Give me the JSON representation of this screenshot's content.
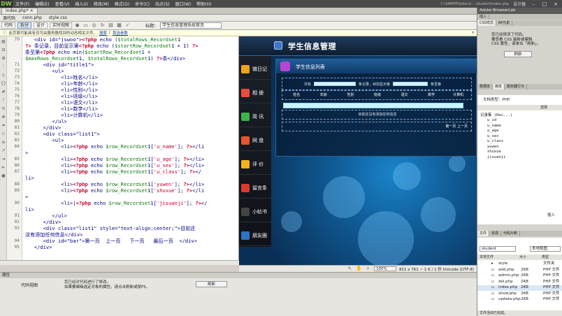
{
  "app": {
    "logo": "DW",
    "menus": [
      "文件(F)",
      "编辑(E)",
      "查看(V)",
      "插入(I)",
      "修改(M)",
      "格式(O)",
      "命令(C)",
      "站点(S)",
      "窗口(W)",
      "帮助(H)"
    ],
    "path": "C:\\XAMPP\\htdocs\\... \\student\\index.php",
    "user": "设计器",
    "min": "–",
    "max": "□",
    "close": "×"
  },
  "doctab": {
    "label": "index.php*",
    "close": "×"
  },
  "related_files": [
    "源代码",
    "conn.php",
    "style.css"
  ],
  "toolbar": {
    "code": "代码",
    "split": "拆分",
    "design": "设计",
    "live": "实时视图",
    "title_label": "标题：",
    "title_value": "学生信息管理系统首页"
  },
  "infobar": {
    "message": "此页面可能具有仅可由服务器找到的动态相关文件。",
    "link1": "搜索",
    "sep": "|",
    "link2": "首选参数",
    "close": "×"
  },
  "code": {
    "lines": [
      {
        "n": "70",
        "html": "   <div id=\"jswoo\"><?php echo ($totalRows_Recordset1"
      },
      {
        "n": "",
        "html": "?> 条记录，目前显示第<?php echo ($startRow_Recordset1 + 1) ?>"
      },
      {
        "n": "",
        "html": "条至第<?php echo min($startRow_Recordset1 +"
      },
      {
        "n": "",
        "html": "$maxRows_Recordset1, $totalRows_Recordset1) ?>条</div>"
      },
      {
        "n": "71",
        "html": "      <div id=\"title1\">"
      },
      {
        "n": "72",
        "html": "         <ul>"
      },
      {
        "n": "73",
        "html": "            <li>姓名</li>"
      },
      {
        "n": "74",
        "html": "            <li>年龄</li>"
      },
      {
        "n": "75",
        "html": "            <li>性别</li>"
      },
      {
        "n": "76",
        "html": "            <li>班级</li>"
      },
      {
        "n": "77",
        "html": "            <li>语文</li>"
      },
      {
        "n": "78",
        "html": "            <li>数学</li>"
      },
      {
        "n": "79",
        "html": "            <li>计算机</li>"
      },
      {
        "n": "80",
        "html": "         </ul>"
      },
      {
        "n": "81",
        "html": "      </div>"
      },
      {
        "n": "82",
        "html": "      <div class=\"list1\">"
      },
      {
        "n": "83",
        "html": "         <ul>"
      },
      {
        "n": "84",
        "html": "            <li><?php echo $row_Recordset1['u_name']; ?></li"
      },
      {
        "n": "",
        "html": ">"
      },
      {
        "n": "85",
        "html": "            <li><?php echo $row_Recordset1['u_age']; ?></li>"
      },
      {
        "n": "86",
        "html": "            <li><?php echo $row_Recordset1['u_sex']; ?></li>"
      },
      {
        "n": "87",
        "html": "            <li><?php echo $row_Recordset1['u_class']; ?></"
      },
      {
        "n": "",
        "html": "li>"
      },
      {
        "n": "88",
        "html": "            <li><?php echo $row_Recordset1['yuwen']; ?></li>"
      },
      {
        "n": "89",
        "html": "            <li><?php echo $row_Recordset1['shuxue']; ?></li"
      },
      {
        "n": "",
        "html": ">"
      },
      {
        "n": "90",
        "html": "            <li>|<?php echo $row_Recordset1['jisuanji']; ?></"
      },
      {
        "n": "",
        "html": "li>"
      },
      {
        "n": "91",
        "html": "         </ul>"
      },
      {
        "n": "92",
        "html": "      </div>"
      },
      {
        "n": "93",
        "html": "      <div class=\"list1\" style=\"text-align:center;\">目前还"
      },
      {
        "n": "",
        "html": "没有添加任何信息</div>"
      },
      {
        "n": "94",
        "html": "      <div id=\"bar\">第一页  上一页   下一页   最后一页  </div>"
      },
      {
        "n": "95",
        "html": "   </div>"
      }
    ]
  },
  "design": {
    "header_title": "学生信息管理",
    "sidebar": [
      {
        "label": "微日记",
        "color": "#f0a21b"
      },
      {
        "label": "相 册",
        "color": "#e84d3c"
      },
      {
        "label": "简 讯",
        "color": "#3cb44b"
      },
      {
        "label": "网 盘",
        "color": "#e8542f"
      },
      {
        "label": "评 价",
        "color": "#f2b21c"
      },
      {
        "label": "留言条",
        "color": "#d93b2f"
      },
      {
        "label": "小帖书",
        "color": "#444444"
      },
      {
        "label": "朋友圈",
        "color": "#2b74c7"
      }
    ],
    "panel_title": "学生信息列表",
    "summary_pre": "共有",
    "summary_mid": "条记录，目前显示第",
    "summary_post": "条至第",
    "columns": [
      "姓名",
      "年龄",
      "性别",
      "班级",
      "语文",
      "数学",
      "计算机"
    ],
    "empty": "目前还没有添加任何信息",
    "nav": "第一页  上一页"
  },
  "status": {
    "zoom": "100%",
    "info": "811 x 761 ~ 1 K / 1 秒 Unicode (UTF-8)"
  },
  "properties": {
    "header": "属性",
    "label": "代码视图",
    "message_1": "您已经对代码进行了修改。",
    "message_2": "如果要编辑选定对象的属性，请点击刷新或按F5。",
    "refresh": "刷新"
  },
  "right": {
    "browserlab": "Adobe BrowserLab",
    "tabs1": [
      "插入",
      "CSS样式",
      "AP元素"
    ],
    "css_msg_1": "您已经修改了代码。",
    "css_msg_2": "要查看 CSS 最新或编辑",
    "css_msg_3": "CSS 属性，请单击「刷新」。",
    "refresh": "刷新",
    "tabs2": [
      "数据库",
      "绑定",
      "服务器行为"
    ],
    "doctype": "文档类型：PHP",
    "bind_cols": [
      "",
      "",
      "选择"
    ],
    "recordset": "记录集 (Rec...)",
    "bind_items": [
      "u_id",
      "u_name",
      "u_age",
      "u_sex",
      "u_class",
      "yuwen",
      "shuxue",
      "jisuanji"
    ],
    "insert": "插入",
    "tabs3": [
      "文件",
      "资源",
      "代码片断"
    ],
    "site": "student",
    "view": "本地视图",
    "file_cols": [
      "本地文件",
      "大小",
      "类型"
    ],
    "files": [
      {
        "name": "style",
        "size": "",
        "type": "文件夹"
      },
      {
        "name": "add.php",
        "size": "2KB",
        "type": "PHP 文件"
      },
      {
        "name": "admin.php",
        "size": "2KB",
        "type": "PHP 文件"
      },
      {
        "name": "del.php",
        "size": "2KB",
        "type": "PHP 文件"
      },
      {
        "name": "index.php",
        "size": "2KB",
        "type": "PHP 文件"
      },
      {
        "name": "show.php",
        "size": "2KB",
        "type": "PHP 文件"
      },
      {
        "name": "updata.php",
        "size": "2KB",
        "type": "PHP 文件"
      }
    ],
    "files_status": "文件活动已完成。"
  }
}
